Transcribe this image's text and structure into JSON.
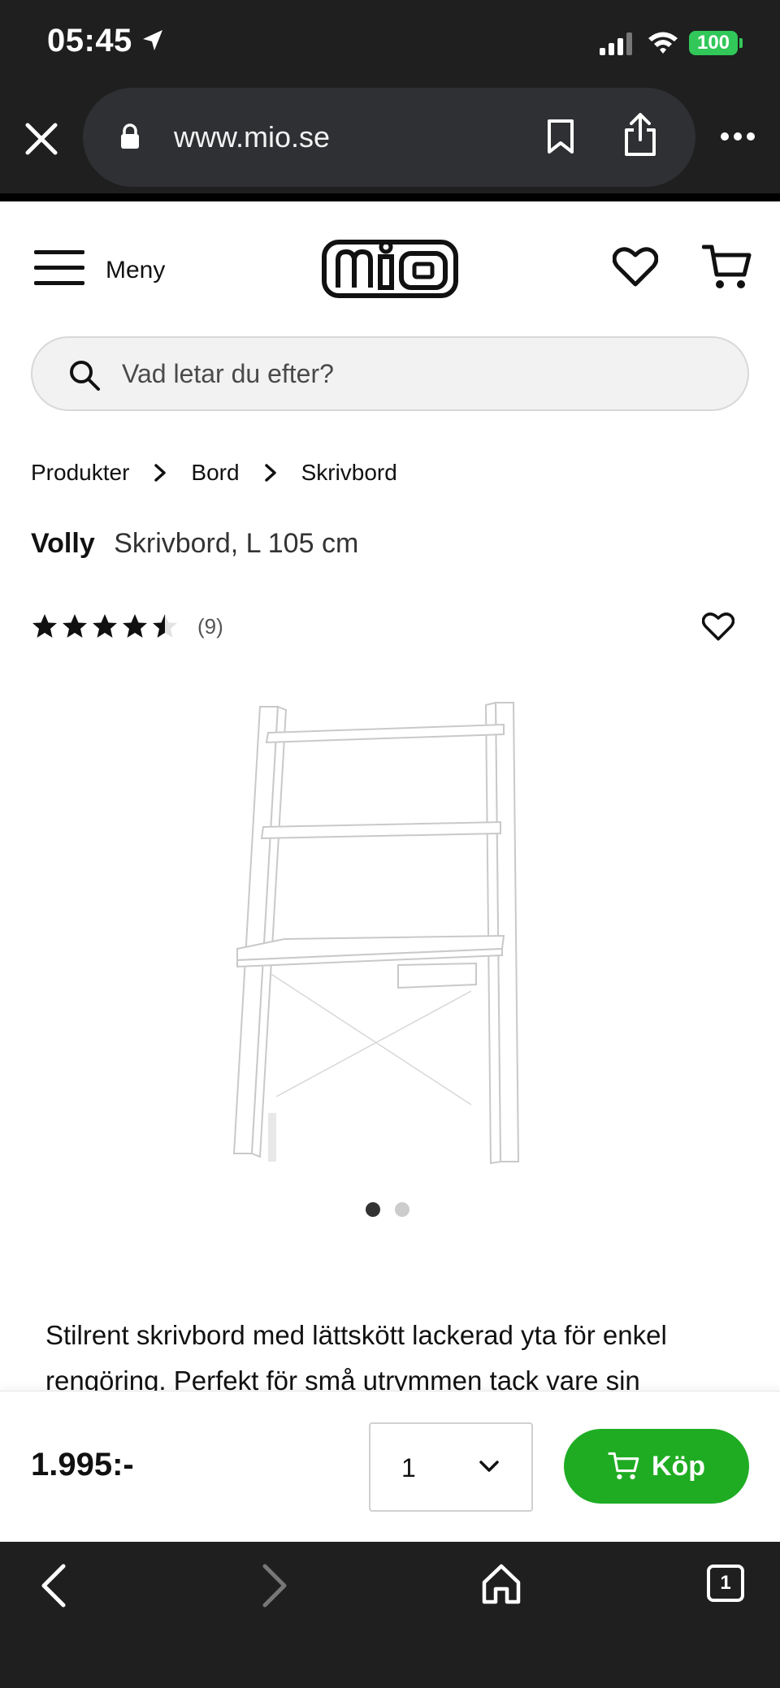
{
  "status_bar": {
    "time": "05:45",
    "battery": "100"
  },
  "browser": {
    "url": "www.mio.se"
  },
  "header": {
    "menu_label": "Meny",
    "logo_text": "mio"
  },
  "search": {
    "placeholder": "Vad letar du efter?"
  },
  "breadcrumb": [
    "Produkter",
    "Bord",
    "Skrivbord"
  ],
  "product": {
    "brand": "Volly",
    "name": "Skrivbord, L 105 cm",
    "rating": 4.5,
    "rating_max": 5,
    "review_count": "(9)",
    "image_count": 2,
    "active_image": 1,
    "description": "Stilrent skrivbord med lättskött lackerad yta för enkel rengöring. Perfekt för små utrymmen tack vare sin"
  },
  "buy_bar": {
    "price": "1.995:-",
    "quantity": "1",
    "buy_label": "Köp"
  },
  "bottom_nav": {
    "tab_count": "1"
  },
  "colors": {
    "accent_green": "#1fac23",
    "battery_green": "#31c759",
    "chrome_dark": "#1f1f1f"
  }
}
